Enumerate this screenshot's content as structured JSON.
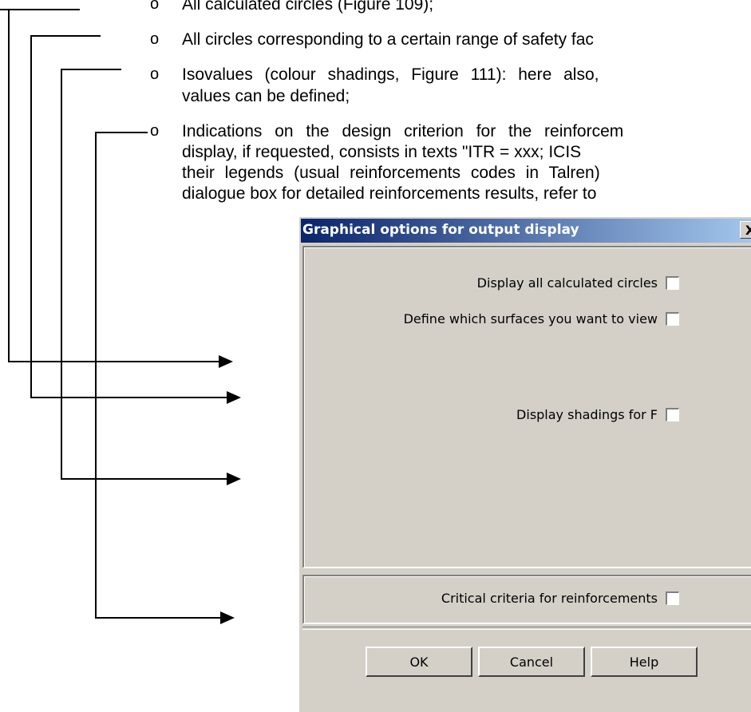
{
  "document": {
    "bullets": [
      "All calculated circles (Figure 109);",
      "All circles corresponding to a certain range of safety fac",
      "Isovalues (colour shadings, Figure 111): here also,",
      "values can be defined;",
      "Indications on the design criterion for the reinforcem",
      "display, if requested, consists in texts \"ITR = xxx; ICIS",
      "their legends (usual reinforcements codes in Talren)",
      "dialogue box for detailed reinforcements results, refer to"
    ],
    "bullet_marker": "o"
  },
  "dialog": {
    "title": "Graphical options for output display",
    "close_label": "X",
    "options": {
      "display_all_circles": "Display all calculated circles",
      "define_surfaces": "Define which surfaces you want to view",
      "display_shadings": "Display shadings for F",
      "critical_criteria": "Critical criteria for reinforcements"
    },
    "buttons": {
      "ok": "OK",
      "cancel": "Cancel",
      "help": "Help"
    }
  }
}
